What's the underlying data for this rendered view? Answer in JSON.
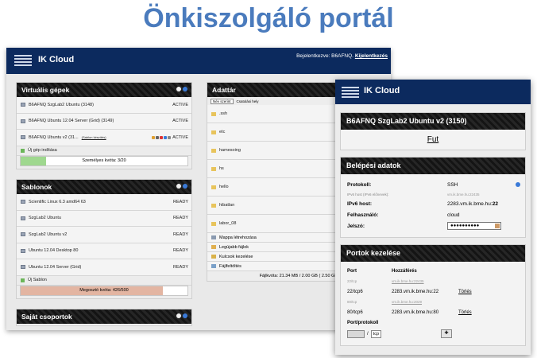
{
  "slide_title": "Önkiszolgáló portál",
  "app_name": "IK Cloud",
  "login": {
    "prefix": "Bejelentkezve: B6AFNQ.",
    "logout": "Kijelentkezés"
  },
  "vms_panel": {
    "title": "Virtuális gépek",
    "items": [
      {
        "name": "B6AFNQ SzgLab2 Ubuntu (3148)",
        "status": "ACTIVE"
      },
      {
        "name": "B6AFNQ Ubuntu 12.04 Server (Grid) (3149)",
        "status": "ACTIVE"
      },
      {
        "name": "B6AFNQ Ubuntu v2 (31...",
        "status": "ACTIVE",
        "extra": "(Sablon készítés)"
      }
    ],
    "new_label": "Új gép indítása",
    "quota_label": "Személyes kvóta: 3/20",
    "quota_fraction": 0.15
  },
  "templates_panel": {
    "title": "Sablonok",
    "items": [
      {
        "name": "Scientific Linux 6.3 amd64 63",
        "status": "READY"
      },
      {
        "name": "SzgLab2 Ubuntu",
        "status": "READY"
      },
      {
        "name": "SzgLab2 Ubuntu v2",
        "status": "READY"
      },
      {
        "name": "Ubuntu 12.04 Desktop 80",
        "status": "READY"
      },
      {
        "name": "Ubuntu 12.04 Server (Grid)",
        "status": "READY"
      }
    ],
    "new_label": "Új Sablon",
    "quota_label": "Megosztó kvóta: 426/500",
    "quota_fraction": 0.852
  },
  "groups_panel": {
    "title": "Saját csoportok"
  },
  "storage_panel": {
    "title": "Adattár",
    "sort_select": "Név szerint",
    "sort_hint": "Csatolási hely",
    "folders": [
      ".ssh",
      "etc",
      "hamesoing",
      "hs",
      "hello",
      "hibatlan",
      "labor_08"
    ],
    "actions": [
      "Mappa létrehozása",
      "Legújabb fájlok",
      "Kulcsok kezelése",
      "Fájlfeltöltés"
    ],
    "footer": "Fájlkvóta: 21.34 MB / 2.00 GB ( 2.50 GB"
  },
  "vm_window": {
    "vm_title": "B6AFNQ SzgLab2 Ubuntu v2 (3150)",
    "run_label": "Fut",
    "login_title": "Belépési adatok",
    "protocol_label": "Protokoll:",
    "protocol_value": "SSH",
    "ipv6_host_hint_label": "IPv6 host (IPv6 előnevek):",
    "ipv6_host_hint_value": "vm.ik.bme.hu:22435",
    "ipv6_host_label": "IPv6 host:",
    "ipv6_host_value": "2283.vm.ik.bme.hu:",
    "ipv6_host_port": "22",
    "user_label": "Felhasználó:",
    "user_value": "cloud",
    "password_label": "Jelszó:",
    "password_value": "●●●●●●●●●●",
    "ports_title": "Portok kezelése",
    "ports_col_port": "Port",
    "ports_col_access": "Hozzáférés",
    "ports": [
      {
        "port": "22/tcp",
        "access": "vm.ik.bme.hu:22435",
        "faint": true,
        "delete": ""
      },
      {
        "port": "22/tcp6",
        "access": "2283.vm.ik.bme.hu:22",
        "faint": false,
        "delete": "Törlés"
      },
      {
        "port": "80/tcp",
        "access": "vm.ik.bme.hu:2029",
        "faint": true,
        "delete": ""
      },
      {
        "port": "80/tcp6",
        "access": "2283.vm.ik.bme.hu:80",
        "faint": false,
        "delete": "Törlés"
      }
    ],
    "port_protocol_label": "Port/protokoll",
    "slash": "/",
    "protocol_option": "tcp"
  },
  "colors": {
    "header": "#0c2a5e",
    "title": "#4a7bbd",
    "quota_green": "#9fd88f",
    "quota_salmon": "#e3b5a2"
  },
  "icons": [
    "machine-icon",
    "folder-icon",
    "info-icon",
    "plus-icon",
    "key-icon",
    "upload-icon",
    "password-reveal-icon"
  ]
}
